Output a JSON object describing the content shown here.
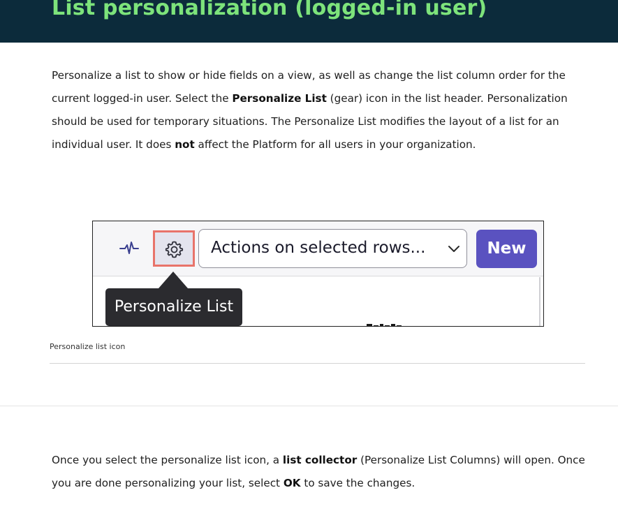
{
  "header": {
    "title": "List personalization (logged-in user)"
  },
  "intro": {
    "part1": "Personalize a list to show or hide fields on a view, as well as change the list column order for the current logged-in user. Select the ",
    "bold1": "Personalize List",
    "part2": " (gear) icon in the list header. Personalization should be used for temporary situations. The Personalize List modifies the layout of a list for an individual user. It does ",
    "bold2": "not",
    "part3": " affect the Platform for all users in your organization."
  },
  "figure": {
    "actions_select_label": "Actions on selected rows...",
    "new_button_label": "New",
    "tooltip_text": "Personalize List",
    "highlight_color": "#e8736a",
    "button_color": "#5a52c0",
    "icons": [
      "pulse-icon",
      "gear-icon",
      "chevron-down-icon"
    ]
  },
  "caption": "Personalize list icon",
  "outro": {
    "part1": "Once you select the personalize list icon, a ",
    "bold1": "list collector",
    "part2": " (Personalize List Columns) will open. Once you are done personalizing your list, select ",
    "bold2": "OK",
    "part3": " to save the changes."
  },
  "colors": {
    "header_bg": "#0c2b3b",
    "title_color": "#7de37b"
  }
}
